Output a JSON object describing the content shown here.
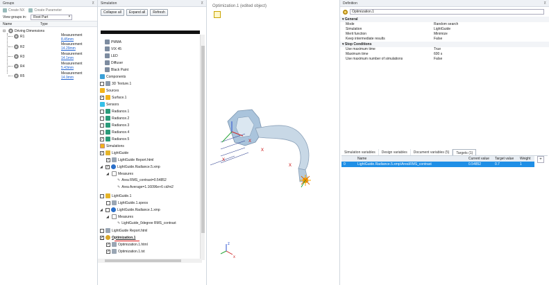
{
  "groups": {
    "title": "Groups",
    "toolbar": {
      "create_nx": "Create NX",
      "create_param": "Create Parameter"
    },
    "view_groups_label": "View groups in:",
    "view_groups_value": "Root Part",
    "col_name": "Name",
    "col_type": "Type",
    "root": "Driving Dimensions",
    "items": [
      {
        "name": "R1",
        "type": "Measurement",
        "value": "8.45mm"
      },
      {
        "name": "R2",
        "type": "Measurement",
        "value": "14.29mm"
      },
      {
        "name": "R3",
        "type": "Measurement",
        "value": "14.1mm"
      },
      {
        "name": "R4",
        "type": "Measurement",
        "value": "5.43mm"
      },
      {
        "name": "R5",
        "type": "Measurement",
        "value": "14.9mm"
      }
    ]
  },
  "simulation": {
    "title": "Simulation",
    "collapse_all": "Collapse all",
    "expand_all": "Expand all",
    "refresh": "Refresh",
    "tree": [
      "PMMA",
      "VIX 45",
      "LED",
      "Diffuser",
      "Black Paint",
      "Components",
      "3D Texture.1",
      "Sources",
      "Surface.1",
      "Sensors",
      "Radiance.1",
      "Radiance.2",
      "Radiance.3",
      "Radiance.4",
      "Radiance.5",
      "Simulations",
      "LightGuide",
      "LightGuide Report.html",
      "LightGuide.Radiance.5.xmp",
      "Measures",
      "Area RMS_contrast=0.54852",
      "Area Average=1.16096e+6 cd/m2",
      "LightGuide.1",
      "LightGuide.1.speos",
      "LightGuide.Radiance.1.xmp",
      "Measures",
      "LightGuide_0degree RMS_contrast",
      "LightGuide Report.html",
      "Optimization.1",
      "Optimization.1.html",
      "Optimization.1.txt"
    ]
  },
  "viewport": {
    "title": "Optimization.1 (edited object)"
  },
  "definition": {
    "title": "Definition",
    "name_value": "Optimization.1",
    "general_label": "General",
    "general": [
      {
        "k": "Mode",
        "v": "Random search"
      },
      {
        "k": "Simulation",
        "v": "LightGuide"
      },
      {
        "k": "Merit function",
        "v": "Minimize"
      },
      {
        "k": "Keep intermediate results",
        "v": "False"
      }
    ],
    "stop_label": "Stop Conditions",
    "stop": [
      {
        "k": "Use maximum time",
        "v": "True"
      },
      {
        "k": "Maximum time",
        "v": "600 s"
      },
      {
        "k": "Use maximum number of simulations",
        "v": "False"
      }
    ],
    "tabs": [
      "Simulation variables",
      "Design variables",
      "Document variables (5)",
      "Targets (1)"
    ],
    "targets_cols": [
      "Name",
      "Current value",
      "Target value",
      "Weight"
    ],
    "targets_row": {
      "id": "0",
      "name": "LightGuide.Radiance.5.xmp\\Area\\RMS_contrast",
      "current": "0.54852",
      "target": "0.7",
      "weight": "1"
    }
  }
}
